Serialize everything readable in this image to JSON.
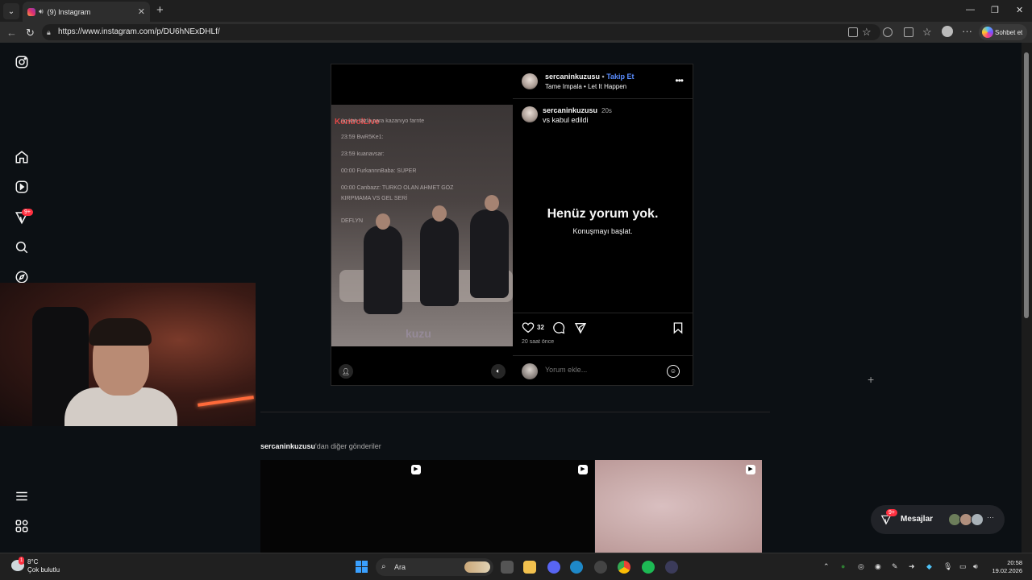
{
  "browser": {
    "tab_title": "(9) Instagram",
    "url": "https://www.instagram.com/p/DU6hNExDHLf/",
    "copilot_label": "Sohbet et"
  },
  "sidebar": {
    "notification_badge": "9+"
  },
  "post": {
    "username": "sercaninkuzusu",
    "separator": "•",
    "follow_label": "Takip Et",
    "audio_artist": "Tame Impala",
    "audio_track": "Let It Happen",
    "caption_username": "sercaninkuzusu",
    "caption_time": "20s",
    "caption_text": "vs kabul edildi",
    "empty_title": "Henüz yorum yok.",
    "empty_subtitle": "Konuşmayı başlat.",
    "likes": "32",
    "posted_ago": "20 saat önce",
    "comment_placeholder": "Yorum ekle...",
    "video_overlay": {
      "brand_prefix": "Kontrol",
      "brand_suffix": "Live",
      "chat_lines": [
        "üç katı fazla para kazanıyo farnte",
        "23:59  BwR5Ke1:",
        "23:59  kuanavsar:",
        "00:00  FurkannnBaba: SÜPER",
        "00:00  Canbazz: TURKO OLAN AHMET GÖZ",
        "KIRPMAMA VS GEL SERİ",
        "DEFLYN"
      ],
      "watermark": "kuzu"
    }
  },
  "more_posts": {
    "username": "sercaninkuzusu",
    "suffix": "'dan diğer gönderiler"
  },
  "messages": {
    "label": "Mesajlar",
    "badge": "9+"
  },
  "taskbar": {
    "temperature": "8°C",
    "weather": "Çok bulutlu",
    "weather_badge": "1",
    "search_label": "Ara",
    "time": "20:58",
    "date": "19.02.2026"
  }
}
